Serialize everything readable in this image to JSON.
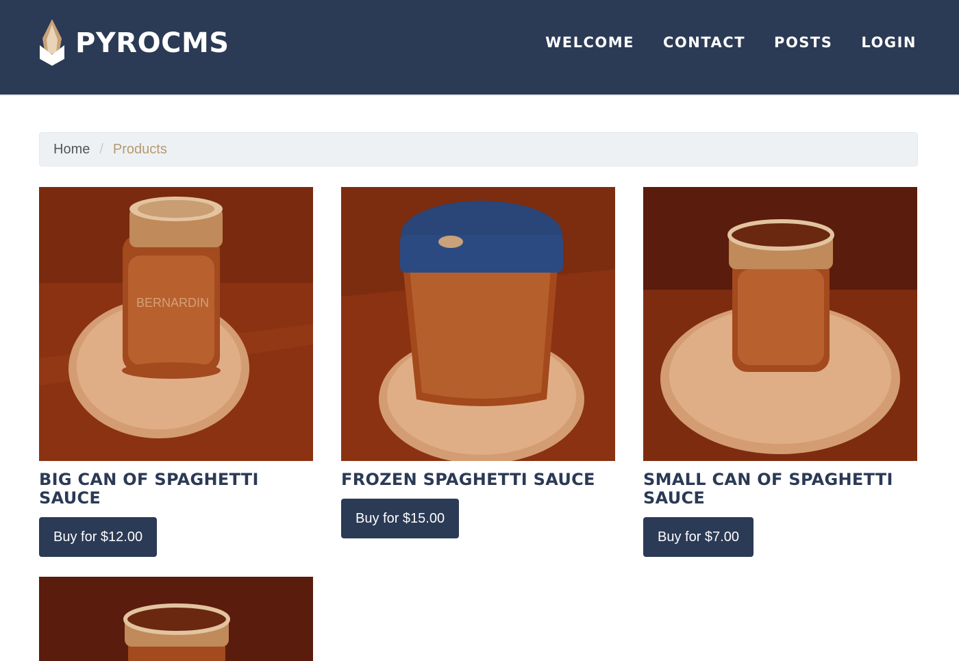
{
  "header": {
    "brand": "PYROCMS",
    "nav": [
      "WELCOME",
      "CONTACT",
      "POSTS",
      "LOGIN"
    ]
  },
  "breadcrumb": {
    "home": "Home",
    "separator": "/",
    "current": "Products"
  },
  "products": [
    {
      "title": "BIG CAN OF SPAGHETTI SAUCE",
      "button": "Buy for $12.00",
      "image": "glass-jar-with-lid"
    },
    {
      "title": "FROZEN SPAGHETTI SAUCE",
      "button": "Buy for $15.00",
      "image": "plastic-container-blue-lid"
    },
    {
      "title": "SMALL CAN OF SPAGHETTI SAUCE",
      "button": "Buy for $7.00",
      "image": "small-jar-open-ring"
    },
    {
      "title": "",
      "button": "",
      "image": "small-jar-open-ring"
    }
  ],
  "colors": {
    "header_bg": "#2b3a55",
    "accent": "#b49a72",
    "button_bg": "#2b3a55"
  }
}
